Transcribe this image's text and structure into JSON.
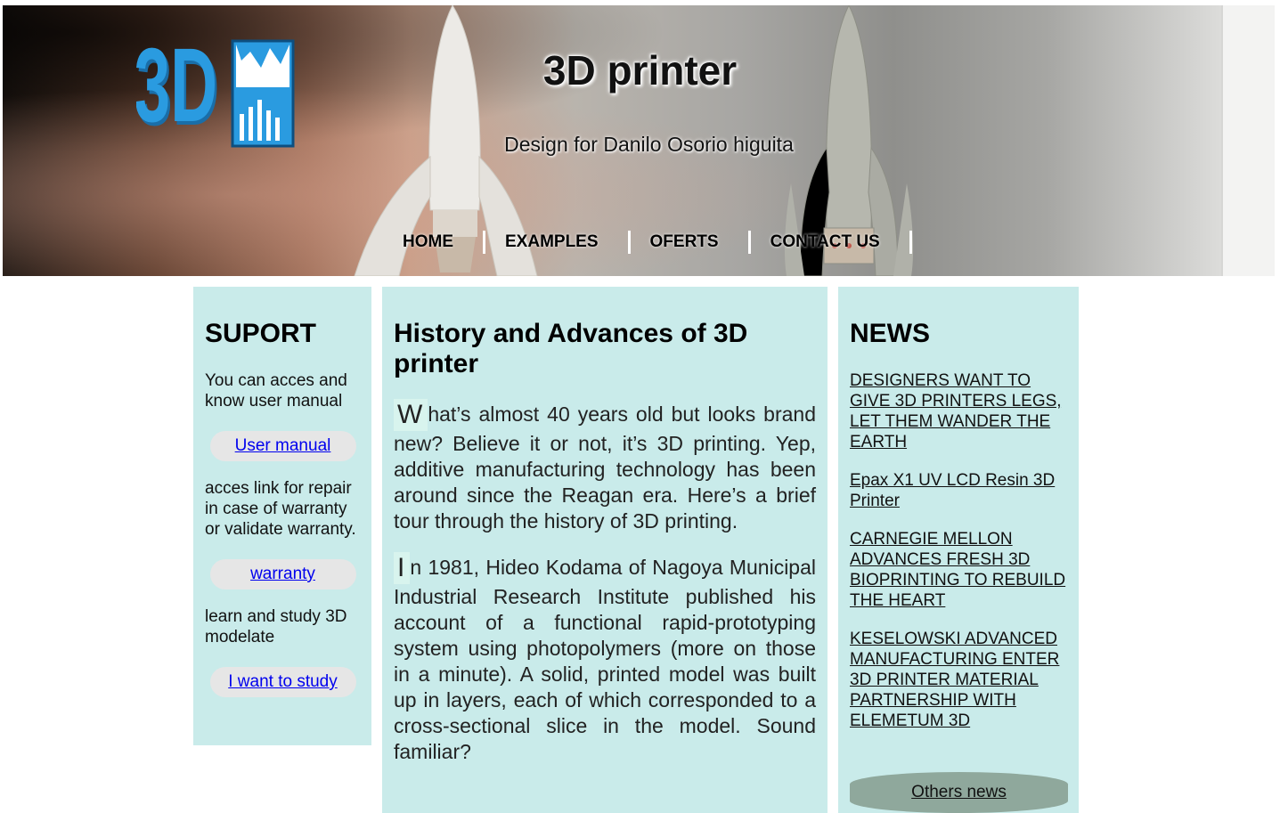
{
  "header": {
    "title": "3D printer",
    "subtitle": "Design for Danilo Osorio higuita",
    "logo_text": "3D"
  },
  "nav": {
    "items": [
      {
        "label": "HOME"
      },
      {
        "label": "EXAMPLES"
      },
      {
        "label": "OFERTS"
      },
      {
        "label": "CONTACT US"
      }
    ]
  },
  "support": {
    "title": "SUPORT",
    "text1": "You can acces and know user manual",
    "link1": "User manual",
    "text2": "acces link for repair in case of warranty or validate warranty.",
    "link2": "warranty",
    "text3": "learn and study 3D modelate",
    "link3": "I want to study"
  },
  "article": {
    "title": "History and Advances of 3D printer",
    "p1_initial": "W",
    "p1_rest": "hat’s almost 40 years old but looks brand new? Believe it or not, it’s 3D printing. Yep, additive manufacturing technology has been around since the Reagan era. Here’s a brief tour through the history of 3D printing.",
    "p2_initial": "I",
    "p2_rest": "n 1981, Hideo Kodama of Nagoya Municipal Industrial Research Institute published his account of a functional rapid-prototyping system using photopolymers (more on those in a minute). A solid, printed model was built up in layers, each of which corresponded to a cross-sectional slice in the model. Sound familiar?"
  },
  "news": {
    "title": "NEWS",
    "items": [
      {
        "label": "DESIGNERS WANT TO GIVE 3D PRINTERS LEGS, LET THEM WANDER THE EARTH"
      },
      {
        "label": "Epax X1 UV LCD Resin 3D Printer"
      },
      {
        "label": "CARNEGIE MELLON ADVANCES FRESH 3D BIOPRINTING TO REBUILD THE HEART"
      },
      {
        "label": "KESELOWSKI ADVANCED MANUFACTURING ENTER 3D PRINTER MATERIAL PARTNERSHIP WITH ELEMETUM 3D"
      }
    ],
    "more_label": "Others news"
  },
  "colors": {
    "panel": "#c9ebea",
    "link": "#0000ee",
    "news_button": "#8fa89c",
    "logo_blue": "#1e8fd0"
  }
}
